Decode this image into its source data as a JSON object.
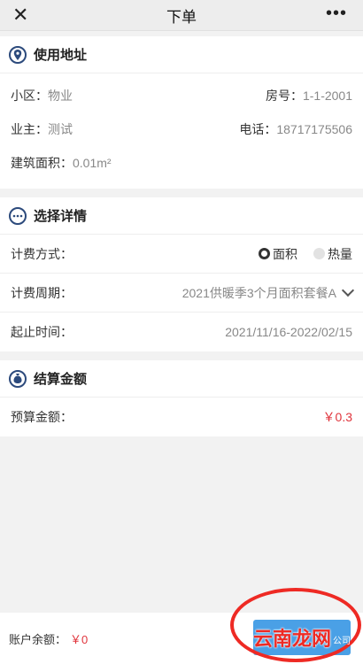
{
  "header": {
    "close_icon": "✕",
    "title": "下单",
    "more_icon": "•••"
  },
  "address": {
    "title": "使用地址",
    "community_label": "小区：",
    "community_value": "物业",
    "room_label": "房号：",
    "room_value": "1-1-2001",
    "owner_label": "业主：",
    "owner_value": "测试",
    "phone_label": "电话：",
    "phone_value": "18717175506",
    "area_label": "建筑面积：",
    "area_value": "0.01m²"
  },
  "details": {
    "title": "选择详情",
    "billing_method_label": "计费方式：",
    "billing_options": [
      {
        "label": "面积",
        "selected": true
      },
      {
        "label": "热量",
        "selected": false
      }
    ],
    "billing_period_label": "计费周期：",
    "billing_period_value": "2021供暖季3个月面积套餐A",
    "time_label": "起止时间：",
    "time_value": "2021/11/16-2022/02/15"
  },
  "settlement": {
    "title": "结算金额",
    "budget_label": "预算金额：",
    "budget_value": "￥0.3"
  },
  "footer": {
    "balance_label": "账户余额：",
    "balance_value": "￥0",
    "watermark": "云南龙网",
    "watermark_small": "公司"
  },
  "colors": {
    "price": "#e0343c",
    "accent": "#4aa0e6",
    "icon": "#2c4a7c",
    "highlight": "#ee2a24"
  }
}
